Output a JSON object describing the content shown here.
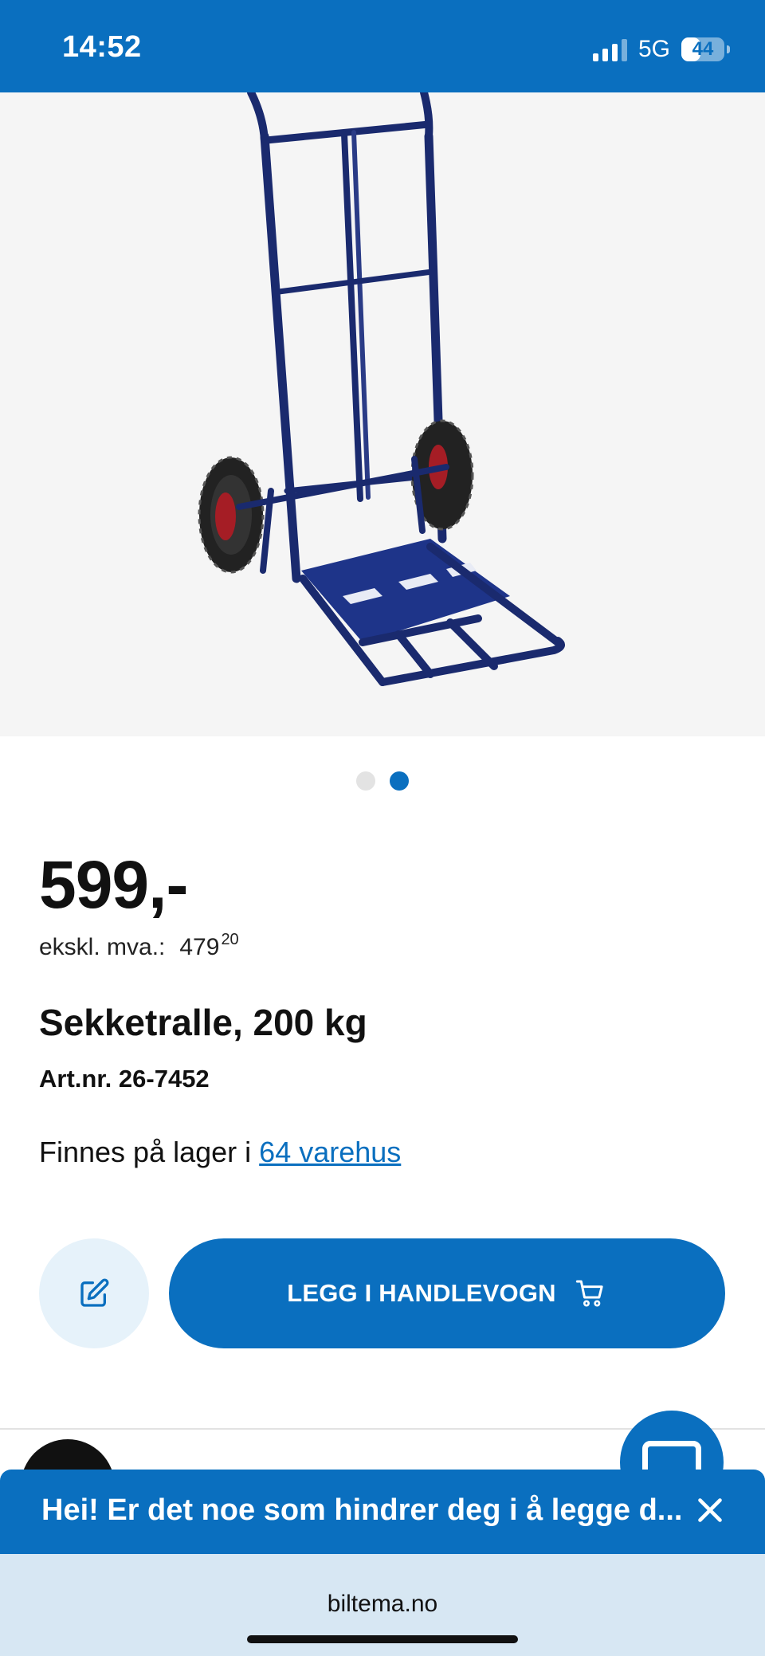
{
  "status_bar": {
    "time": "14:52",
    "network": "5G",
    "battery": "44",
    "battery_level": 0.44
  },
  "carousel": {
    "total": 2,
    "active_index": 1
  },
  "product": {
    "price": "599,-",
    "vat_label": "ekskl. mva.:",
    "vat_value": "479",
    "vat_cents": "20",
    "name": "Sekketralle, 200 kg",
    "art_nr": "Art.nr. 26-7452",
    "stock_prefix": "Finnes på lager i",
    "stock_link": "64 varehus"
  },
  "actions": {
    "cart_label": "LEGG I HANDLEVOGN"
  },
  "chat": {
    "banner_text": "Hei! Er det noe som hindrer deg i å legge d..."
  },
  "browser": {
    "url": "biltema.no"
  },
  "colors": {
    "brand_blue": "#0a6fbf",
    "edit_bg": "#e6f2fa",
    "image_bg": "#f5f5f5",
    "browser_bg": "#d7e7f3"
  },
  "icons": {
    "edit": "pencil-square-icon",
    "cart": "shopping-cart-icon",
    "close": "close-icon",
    "chat": "chat-bubble-icon"
  }
}
